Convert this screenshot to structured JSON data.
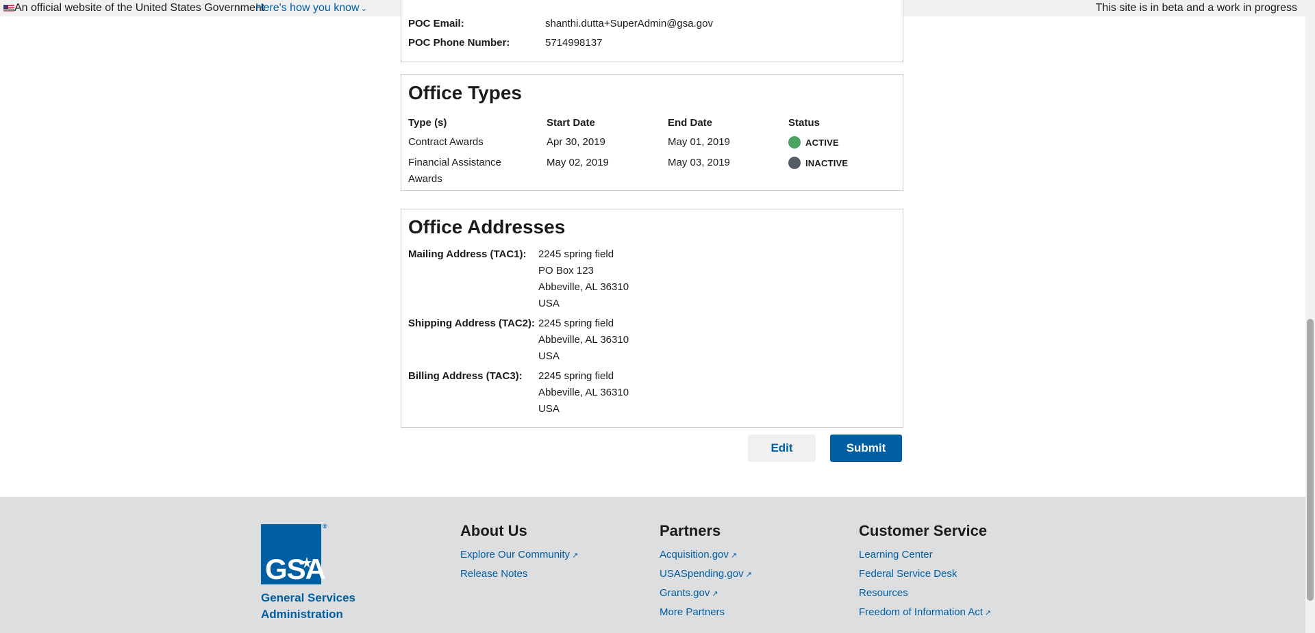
{
  "banner": {
    "official": "An official website of the United States Government",
    "how_know": "Here's how you know",
    "beta": "This site is in beta and a work in progress"
  },
  "poc": {
    "email_label": "POC Email:",
    "email_value": "shanthi.dutta+SuperAdmin@gsa.gov",
    "phone_label": "POC Phone Number:",
    "phone_value": "5714998137"
  },
  "office_types": {
    "title": "Office Types",
    "headers": [
      "Type (s)",
      "Start Date",
      "End Date",
      "Status"
    ],
    "rows": [
      {
        "type_line1": "Contract Awards",
        "type_line2": "",
        "start": "Apr 30, 2019",
        "end": "May 01, 2019",
        "status": "ACTIVE",
        "status_color": "#4aa564"
      },
      {
        "type_line1": "Financial Assistance",
        "type_line2": "Awards",
        "start": "May 02, 2019",
        "end": "May 03, 2019",
        "status": "INACTIVE",
        "status_color": "#565c65"
      }
    ]
  },
  "addresses": {
    "title": "Office Addresses",
    "mailing_label": "Mailing Address (TAC1):",
    "mailing": [
      "2245 spring field",
      "PO Box 123",
      "Abbeville, AL 36310",
      "USA"
    ],
    "shipping_label": "Shipping Address (TAC2):",
    "shipping": [
      "2245 spring field",
      "Abbeville, AL 36310",
      "USA"
    ],
    "billing_label": "Billing Address (TAC3):",
    "billing": [
      "2245 spring field",
      "Abbeville, AL 36310",
      "USA"
    ]
  },
  "actions": {
    "edit": "Edit",
    "submit": "Submit"
  },
  "footer": {
    "logo_text": "GSA",
    "org_line1": "General Services",
    "org_line2": "Administration",
    "about": {
      "heading": "About Us",
      "links": [
        "Explore Our Community",
        "Release Notes"
      ]
    },
    "partners": {
      "heading": "Partners",
      "links": [
        "Acquisition.gov",
        "USASpending.gov",
        "Grants.gov",
        "More Partners"
      ]
    },
    "customer": {
      "heading": "Customer Service",
      "links": [
        "Learning Center",
        "Federal Service Desk",
        "Resources",
        "Freedom of Information Act"
      ]
    }
  },
  "colors": {
    "link": "#005ea2",
    "active": "#4aa564",
    "inactive": "#565c65",
    "footer_bg": "#dcdee0"
  }
}
